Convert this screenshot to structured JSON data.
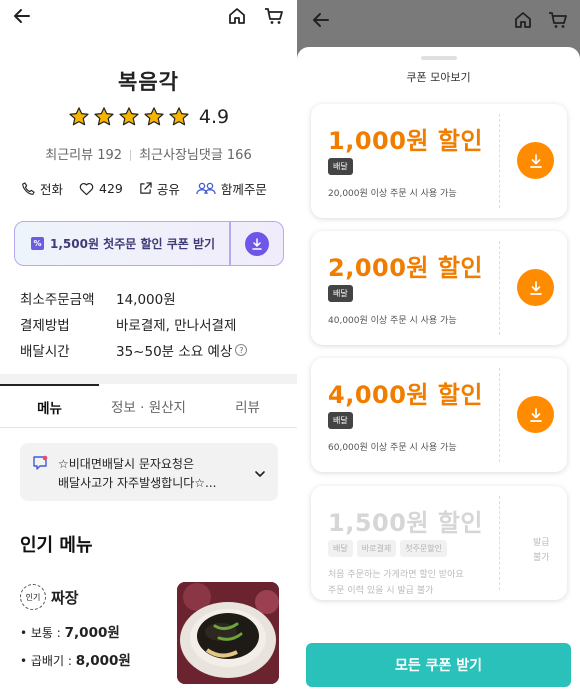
{
  "left": {
    "store_name": "복음각",
    "rating": "4.9",
    "star_count": 5,
    "reviews": {
      "recent_reviews": "최근리뷰 192",
      "owner_comments": "최근사장님댓글 166"
    },
    "actions": {
      "call": "전화",
      "likes": "429",
      "share": "공유",
      "together": "함께주문"
    },
    "coupon_banner": {
      "text": "1,500원 첫주문 할인 쿠폰 받기",
      "badge": "%"
    },
    "info": [
      {
        "label": "최소주문금액",
        "value": "14,000원"
      },
      {
        "label": "결제방법",
        "value": "바로결제, 만나서결제"
      },
      {
        "label": "배달시간",
        "value": "35~50분 소요 예상"
      }
    ],
    "help_glyph": "?",
    "tabs": [
      "메뉴",
      "정보 · 원산지",
      "리뷰"
    ],
    "notice": {
      "line1": "☆비대면배달시 문자요청은",
      "line2": "배달사고가 자주발생합니다☆..."
    },
    "section_title": "인기 메뉴",
    "menu_item": {
      "badge": "인기",
      "name": "짜장",
      "price1_label": "• 보통 : ",
      "price1_value": "7,000원",
      "price2_label": "• 곱배기 : ",
      "price2_value": "8,000원"
    }
  },
  "right": {
    "sheet_title": "쿠폰 모아보기",
    "coupons": [
      {
        "amount": "1,000원 할인",
        "tag": "배달",
        "condition": "20,000원 이상 주문 시 사용 가능"
      },
      {
        "amount": "2,000원 할인",
        "tag": "배달",
        "condition": "40,000원 이상 주문 시 사용 가능"
      },
      {
        "amount": "4,000원 할인",
        "tag": "배달",
        "condition": "60,000원 이상 주문 시 사용 가능"
      }
    ],
    "disabled_coupon": {
      "amount": "1,500원 할인",
      "tags": [
        "배달",
        "바로결제",
        "첫주문할인"
      ],
      "condition_line1": "처음 주문하는 가게라면 할인 받아요",
      "condition_line2": "주문 이력 있을 시 발급 불가",
      "status_line1": "발급",
      "status_line2": "불가"
    },
    "all_button": "모든 쿠폰 받기"
  },
  "colors": {
    "accent_orange": "#f07d00",
    "download_orange": "#ff8b00",
    "teal_button": "#2bc1bb",
    "purple": "#6d56e8",
    "star_yellow": "#f7b500"
  }
}
